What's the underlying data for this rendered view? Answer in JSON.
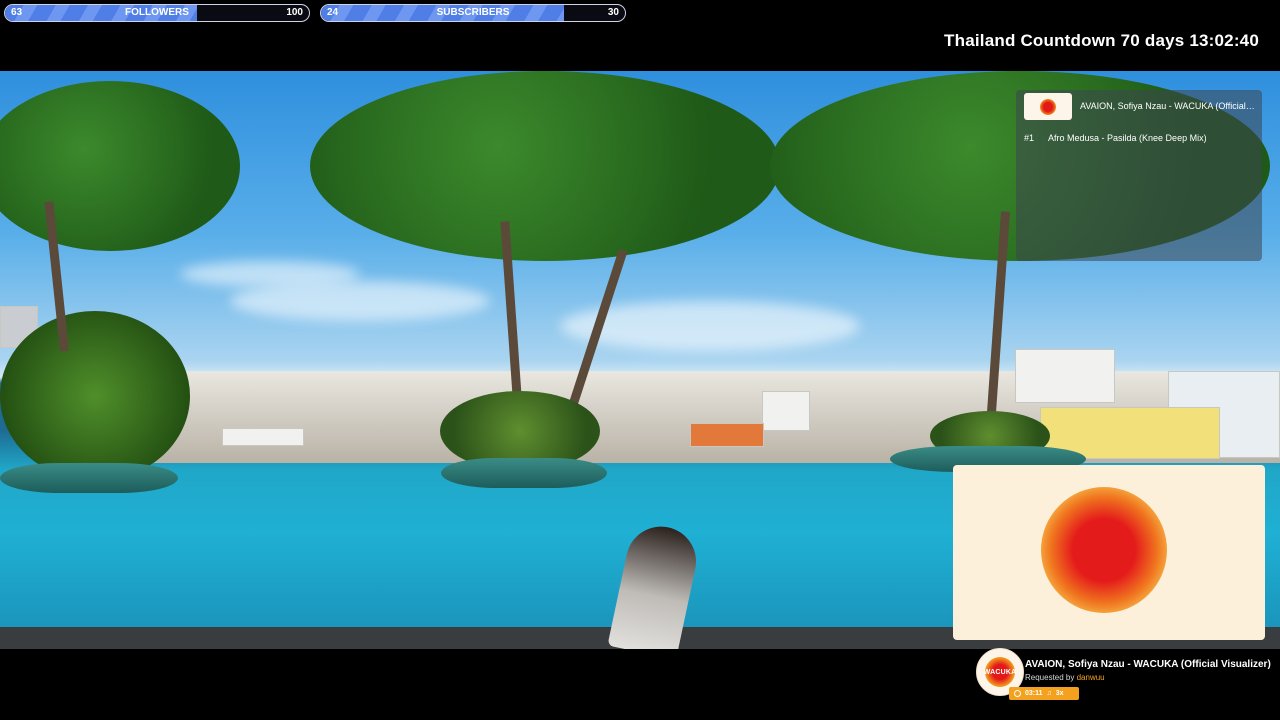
{
  "goals": [
    {
      "id": "followers",
      "current": "63",
      "label": "FOLLOWERS",
      "target": "100",
      "progress": 0.63
    },
    {
      "id": "subscribers",
      "current": "24",
      "label": "SUBSCRIBERS",
      "target": "30",
      "progress": 0.8
    }
  ],
  "countdown": "Thailand Countdown 70 days 13:02:40",
  "queue": {
    "now_playing": "AVAION, Sofiya Nzau - WACUKA (Official Visualizer)",
    "items": [
      {
        "index": "#1",
        "title": "Afro Medusa - Pasilda (Knee Deep Mix)"
      }
    ]
  },
  "now_playing": {
    "art_text": "WACUKA",
    "title": "AVAION, Sofiya Nzau - WACUKA (Official Visualizer)",
    "requested_prefix": "Requested by",
    "requested_by": "danwuu",
    "time": "03:11",
    "plays": "3x"
  },
  "colors": {
    "accent": "#f3a11f",
    "goal_fill": "#4f7fe6",
    "viz_background": "#fdf0da",
    "viz_core": "#e41b1b"
  }
}
